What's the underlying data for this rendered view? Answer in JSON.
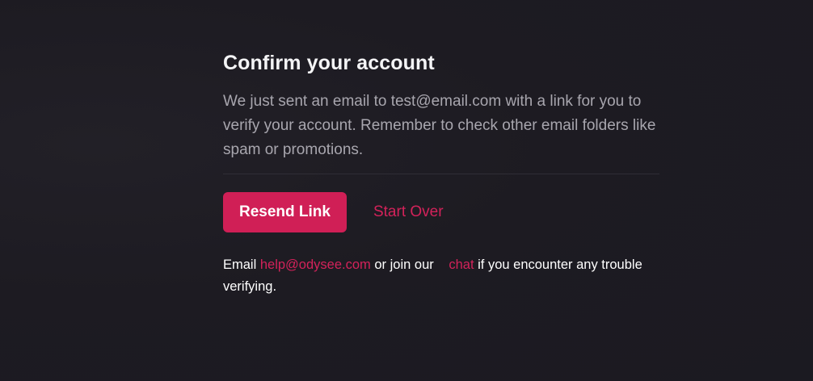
{
  "confirm": {
    "title": "Confirm your account",
    "message": "We just sent an email to test@email.com with a link for you to verify your account. Remember to check other email folders like spam or promotions.",
    "resend_label": "Resend Link",
    "start_over_label": "Start Over"
  },
  "help": {
    "prefix": "Email",
    "email": "help@odysee.com",
    "middle": "or join our",
    "chat": "chat",
    "suffix": "if you encounter any trouble verifying."
  },
  "colors": {
    "background": "#1d1b22",
    "accent": "#d01f56",
    "muted_text": "#a8a6ae"
  }
}
